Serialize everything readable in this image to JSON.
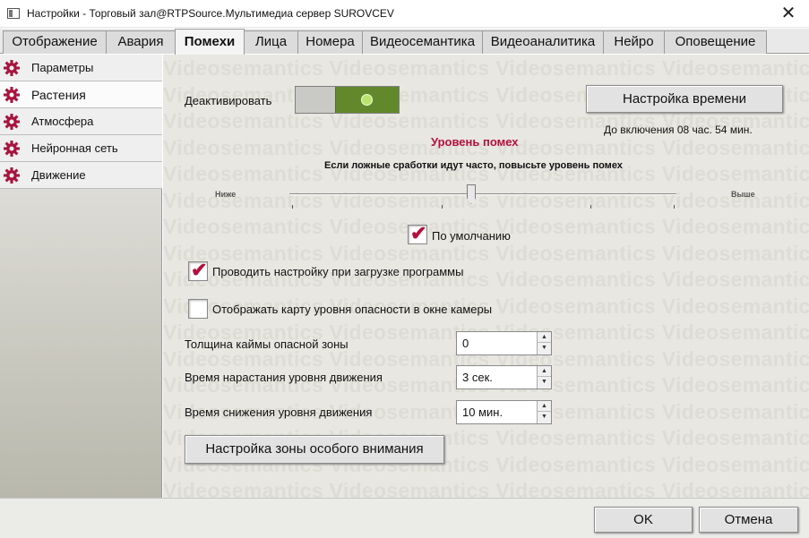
{
  "window": {
    "title": "Настройки - Торговый зал@RTPSource.Мультимедиа сервер SUROVCEV",
    "close_symbol": "✕"
  },
  "tabs": [
    {
      "label": "Отображение"
    },
    {
      "label": "Авария"
    },
    {
      "label": "Помехи"
    },
    {
      "label": "Лица"
    },
    {
      "label": "Номера"
    },
    {
      "label": "Видеосемантика"
    },
    {
      "label": "Видеоаналитика"
    },
    {
      "label": "Нейро"
    },
    {
      "label": "Оповещение"
    }
  ],
  "active_tab": "Помехи",
  "sidebar": {
    "items": [
      {
        "label": "Параметры",
        "icon": "gear-icon"
      },
      {
        "label": "Растения",
        "icon": "gear-icon"
      },
      {
        "label": "Атмосфера",
        "icon": "gear-icon"
      },
      {
        "label": "Нейронная сеть",
        "icon": "gear-icon"
      },
      {
        "label": "Движение",
        "icon": "gear-icon"
      }
    ],
    "active": "Растения"
  },
  "watermark": "Videosemantics",
  "main": {
    "deactivate_label": "Деактивировать",
    "deactivate_toggle_on": true,
    "time_settings_button": "Настройка времени",
    "time_until_enable": "До включения 08 час. 54 мин.",
    "noise_level_title": "Уровень помех",
    "noise_level_hint": "Если ложные сработки идут часто, повысьте уровень помех",
    "slider_low": "Ниже",
    "slider_high": "Выше",
    "slider_value": 0.5,
    "default_checkbox_label": "По умолчанию",
    "default_checked": true,
    "autoconfig_label": "Проводить настройку при загрузке программы",
    "autoconfig_checked": true,
    "danger_map_label": "Отображать карту уровня опасности в окне камеры",
    "danger_map_checked": false,
    "border_thickness_label": "Толщина каймы опасной зоны",
    "border_thickness_value": "0",
    "rise_time_label": "Время нарастания уровня движения",
    "rise_time_value": "3 сек.",
    "fall_time_label": "Время снижения уровня движения",
    "fall_time_value": "10 мин.",
    "attention_zone_button": "Настройка зоны особого внимания"
  },
  "footer": {
    "ok_label": "OK",
    "cancel_label": "Отмена"
  },
  "colors": {
    "accent": "#b4103d",
    "toggle_on": "#62882c"
  }
}
